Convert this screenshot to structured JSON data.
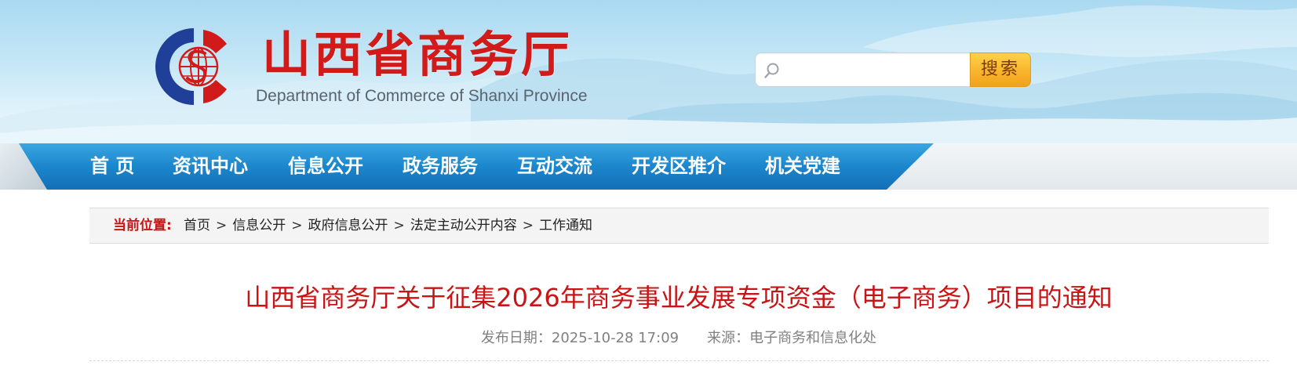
{
  "header": {
    "site_title": "山西省商务厅",
    "site_subtitle": "Department of Commerce of Shanxi Province",
    "logo_icon": "commerce-emblem-icon",
    "search": {
      "placeholder": "",
      "value": "",
      "button_label": "搜索",
      "icon": "search-icon"
    }
  },
  "nav": {
    "items": [
      {
        "label": "首  页"
      },
      {
        "label": "资讯中心"
      },
      {
        "label": "信息公开"
      },
      {
        "label": "政务服务"
      },
      {
        "label": "互动交流"
      },
      {
        "label": "开发区推介"
      },
      {
        "label": "机关党建"
      }
    ]
  },
  "breadcrumb": {
    "label": "当前位置:",
    "items": [
      "首页",
      "信息公开",
      "政府信息公开",
      "法定主动公开内容",
      "工作通知"
    ],
    "separator": ">"
  },
  "article": {
    "title": "山西省商务厅关于征集2026年商务事业发展专项资金（电子商务）项目的通知",
    "published": "发布日期：2025-10-28 17:09",
    "source": "来源：电子商务和信息化处"
  },
  "colors": {
    "brand_red": "#d11a1a",
    "nav_blue": "#1c86cc",
    "search_button": "#f8b52c",
    "title_red": "#c81414"
  }
}
